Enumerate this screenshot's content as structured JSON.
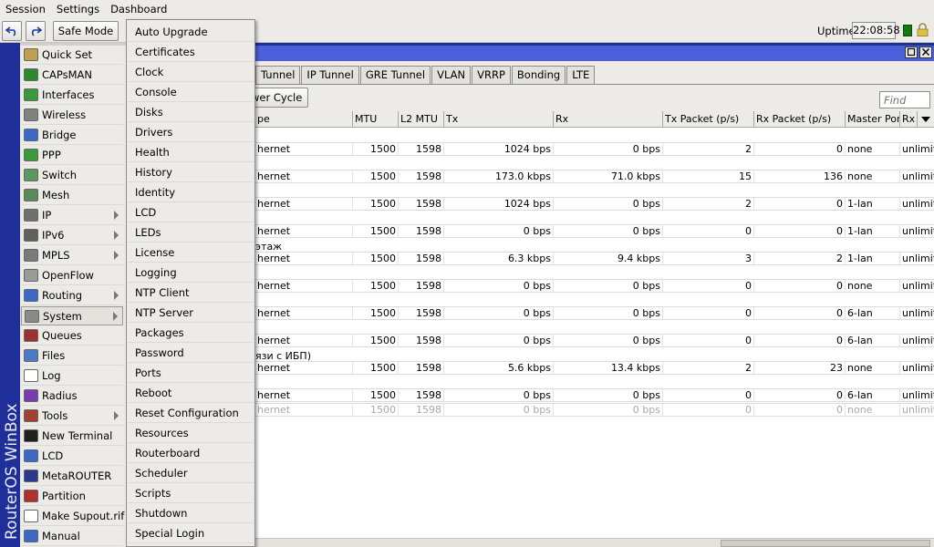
{
  "menubar": [
    "Session",
    "Settings",
    "Dashboard"
  ],
  "toolbar": {
    "undo_icon": "undo-icon",
    "redo_icon": "redo-icon",
    "safe_mode": "Safe Mode",
    "uptime_label": "Uptime:",
    "uptime_value": "22:08:58"
  },
  "strip": {
    "text": "RouterOS WinBox"
  },
  "sidebar": [
    {
      "label": "Quick Set",
      "icon": "quick-set-icon",
      "color": "#c0a050",
      "arrow": false
    },
    {
      "label": "CAPsMAN",
      "icon": "capsman-icon",
      "color": "#2a8a2a",
      "arrow": false
    },
    {
      "label": "Interfaces",
      "icon": "interfaces-icon",
      "color": "#3a9a3a",
      "arrow": false
    },
    {
      "label": "Wireless",
      "icon": "wireless-icon",
      "color": "#808080",
      "arrow": false
    },
    {
      "label": "Bridge",
      "icon": "bridge-icon",
      "color": "#3a68c8",
      "arrow": false
    },
    {
      "label": "PPP",
      "icon": "ppp-icon",
      "color": "#3a9a3a",
      "arrow": false
    },
    {
      "label": "Switch",
      "icon": "switch-icon",
      "color": "#5a9a5a",
      "arrow": false
    },
    {
      "label": "Mesh",
      "icon": "mesh-icon",
      "color": "#5a8a5a",
      "arrow": false
    },
    {
      "label": "IP",
      "icon": "ip-icon",
      "color": "#707070",
      "arrow": true
    },
    {
      "label": "IPv6",
      "icon": "ipv6-icon",
      "color": "#606060",
      "arrow": true
    },
    {
      "label": "MPLS",
      "icon": "mpls-icon",
      "color": "#7a7a7a",
      "arrow": true
    },
    {
      "label": "OpenFlow",
      "icon": "openflow-icon",
      "color": "#9a9a9a",
      "arrow": false
    },
    {
      "label": "Routing",
      "icon": "routing-icon",
      "color": "#3a68c8",
      "arrow": true
    },
    {
      "label": "System",
      "icon": "system-gear-icon",
      "color": "#8a8a8a",
      "arrow": true
    },
    {
      "label": "Queues",
      "icon": "queues-icon",
      "color": "#a03030",
      "arrow": false
    },
    {
      "label": "Files",
      "icon": "files-icon",
      "color": "#4a7ac8",
      "arrow": false
    },
    {
      "label": "Log",
      "icon": "log-icon",
      "color": "#ffffff",
      "arrow": false
    },
    {
      "label": "Radius",
      "icon": "radius-icon",
      "color": "#7a3ab0",
      "arrow": false
    },
    {
      "label": "Tools",
      "icon": "tools-icon",
      "color": "#a04030",
      "arrow": true
    },
    {
      "label": "New Terminal",
      "icon": "terminal-icon",
      "color": "#202020",
      "arrow": false
    },
    {
      "label": "LCD",
      "icon": "lcd-icon",
      "color": "#3a68c8",
      "arrow": false
    },
    {
      "label": "MetaROUTER",
      "icon": "metarouter-icon",
      "color": "#2a3a8a",
      "arrow": false
    },
    {
      "label": "Partition",
      "icon": "partition-icon",
      "color": "#b03030",
      "arrow": false
    },
    {
      "label": "Make Supout.rif",
      "icon": "supout-icon",
      "color": "#ffffff",
      "arrow": false
    },
    {
      "label": "Manual",
      "icon": "manual-icon",
      "color": "#3a68c8",
      "arrow": false
    }
  ],
  "submenu": [
    "Auto Upgrade",
    "Certificates",
    "Clock",
    "Console",
    "Disks",
    "Drivers",
    "Health",
    "History",
    "Identity",
    "LCD",
    "LEDs",
    "License",
    "Logging",
    "NTP Client",
    "NTP Server",
    "Packages",
    "Password",
    "Ports",
    "Reboot",
    "Reset Configuration",
    "Resources",
    "Routerboard",
    "Scheduler",
    "Scripts",
    "Shutdown",
    "Special Login"
  ],
  "window": {
    "tabs": [
      "Tunnel",
      "IP Tunnel",
      "GRE Tunnel",
      "VLAN",
      "VRRP",
      "Bonding",
      "LTE"
    ],
    "power_cycle": "wer Cycle",
    "find_placeholder": "Find",
    "columns": [
      "pe",
      "MTU",
      "L2 MTU",
      "Tx",
      "Rx",
      "Tx Packet (p/s)",
      "Rx Packet (p/s)",
      "Master Port",
      "Rx"
    ],
    "rows": [
      {
        "comment": "",
        "type": "hernet",
        "mtu": "1500",
        "l2mtu": "1598",
        "tx": "1024 bps",
        "rx": "0 bps",
        "txp": "2",
        "rxp": "0",
        "master": "none",
        "rxx": "unlimit"
      },
      {
        "comment": "",
        "type": "hernet",
        "mtu": "1500",
        "l2mtu": "1598",
        "tx": "173.0 kbps",
        "rx": "71.0 kbps",
        "txp": "15",
        "rxp": "136",
        "master": "none",
        "rxx": "unlimit"
      },
      {
        "comment": "",
        "type": "hernet",
        "mtu": "1500",
        "l2mtu": "1598",
        "tx": "1024 bps",
        "rx": "0 bps",
        "txp": "2",
        "rxp": "0",
        "master": "1-lan",
        "rxx": "unlimit"
      },
      {
        "comment": "",
        "type": "hernet",
        "mtu": "1500",
        "l2mtu": "1598",
        "tx": "0 bps",
        "rx": "0 bps",
        "txp": "0",
        "rxp": "0",
        "master": "1-lan",
        "rxx": "unlimit"
      },
      {
        "comment": "этаж",
        "type": "hernet",
        "mtu": "1500",
        "l2mtu": "1598",
        "tx": "6.3 kbps",
        "rx": "9.4 kbps",
        "txp": "3",
        "rxp": "2",
        "master": "1-lan",
        "rxx": "unlimit"
      },
      {
        "comment": "",
        "type": "hernet",
        "mtu": "1500",
        "l2mtu": "1598",
        "tx": "0 bps",
        "rx": "0 bps",
        "txp": "0",
        "rxp": "0",
        "master": "none",
        "rxx": "unlimit"
      },
      {
        "comment": "",
        "type": "hernet",
        "mtu": "1500",
        "l2mtu": "1598",
        "tx": "0 bps",
        "rx": "0 bps",
        "txp": "0",
        "rxp": "0",
        "master": "6-lan",
        "rxx": "unlimit"
      },
      {
        "comment": "",
        "type": "hernet",
        "mtu": "1500",
        "l2mtu": "1598",
        "tx": "0 bps",
        "rx": "0 bps",
        "txp": "0",
        "rxp": "0",
        "master": "6-lan",
        "rxx": "unlimit"
      },
      {
        "comment": "язи с ИБП)",
        "type": "hernet",
        "mtu": "1500",
        "l2mtu": "1598",
        "tx": "5.6 kbps",
        "rx": "13.4 kbps",
        "txp": "2",
        "rxp": "23",
        "master": "none",
        "rxx": "unlimit"
      },
      {
        "comment": "",
        "type": "hernet",
        "mtu": "1500",
        "l2mtu": "1598",
        "tx": "0 bps",
        "rx": "0 bps",
        "txp": "0",
        "rxp": "0",
        "master": "6-lan",
        "rxx": "unlimit"
      },
      {
        "comment": "",
        "type": "hernet",
        "mtu": "1500",
        "l2mtu": "1598",
        "tx": "0 bps",
        "rx": "0 bps",
        "txp": "0",
        "rxp": "0",
        "master": "none",
        "rxx": "unlimit",
        "disabled": true
      }
    ]
  }
}
